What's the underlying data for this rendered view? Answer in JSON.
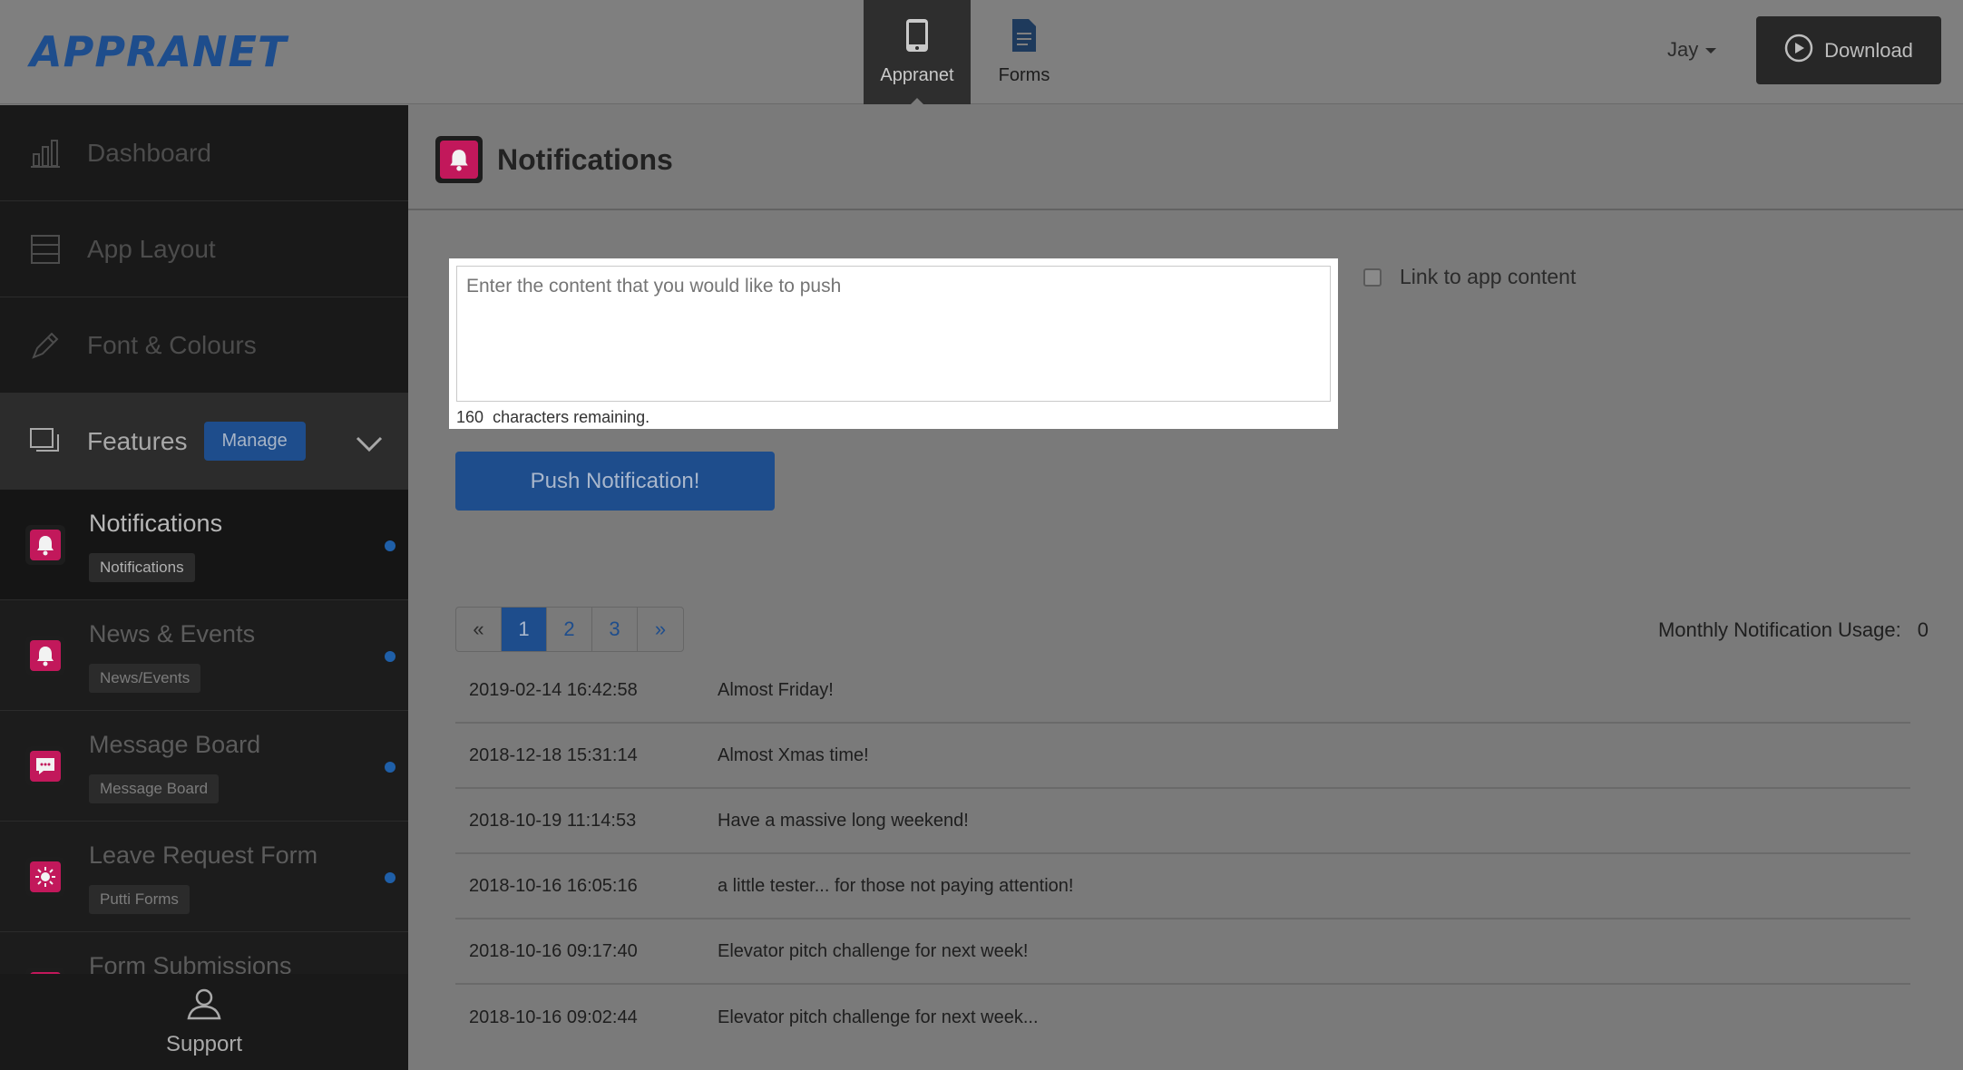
{
  "app": {
    "logo": "APPRANET"
  },
  "topnav": {
    "items": [
      {
        "label": "Appranet",
        "icon": "phone-icon",
        "active": true
      },
      {
        "label": "Forms",
        "icon": "document-icon",
        "active": false
      }
    ],
    "user": "Jay",
    "download_label": "Download"
  },
  "sidebar": {
    "items": [
      {
        "label": "Dashboard",
        "icon": "chart-icon"
      },
      {
        "label": "App Layout",
        "icon": "layout-icon"
      },
      {
        "label": "Font & Colours",
        "icon": "pencil-icon"
      }
    ],
    "features": {
      "label": "Features",
      "manage_label": "Manage"
    },
    "feature_items": [
      {
        "title": "Notifications",
        "tag": "Notifications",
        "icon": "bell-icon"
      },
      {
        "title": "News & Events",
        "tag": "News/Events",
        "icon": "bell-icon"
      },
      {
        "title": "Message Board",
        "tag": "Message Board",
        "icon": "chat-icon"
      },
      {
        "title": "Leave Request Form",
        "tag": "Putti Forms",
        "icon": "sun-icon"
      },
      {
        "title": "Form Submissions",
        "tag": "",
        "icon": "form-icon"
      }
    ],
    "support_label": "Support"
  },
  "main": {
    "title": "Notifications",
    "compose": {
      "placeholder": "Enter the content that you would like to push",
      "chars_remaining": "160",
      "chars_label": "characters remaining."
    },
    "link_label": "Link to app content",
    "push_label": "Push Notification!",
    "pagination": {
      "prev": "«",
      "pages": [
        "1",
        "2",
        "3"
      ],
      "next": "»",
      "current": "1"
    },
    "usage": {
      "label": "Monthly Notification Usage:",
      "value": "0"
    },
    "history": [
      {
        "date": "2019-02-14 16:42:58",
        "message": "Almost Friday!"
      },
      {
        "date": "2018-12-18 15:31:14",
        "message": "Almost Xmas time!"
      },
      {
        "date": "2018-10-19 11:14:53",
        "message": "Have a massive long weekend!"
      },
      {
        "date": "2018-10-16 16:05:16",
        "message": "a little tester... for those not paying attention!"
      },
      {
        "date": "2018-10-16 09:17:40",
        "message": "Elevator pitch challenge for next week!"
      },
      {
        "date": "2018-10-16 09:02:44",
        "message": "Elevator pitch challenge for next week..."
      }
    ]
  },
  "colors": {
    "accent": "#1e4d8c",
    "feature_icon": "#c2185b"
  }
}
